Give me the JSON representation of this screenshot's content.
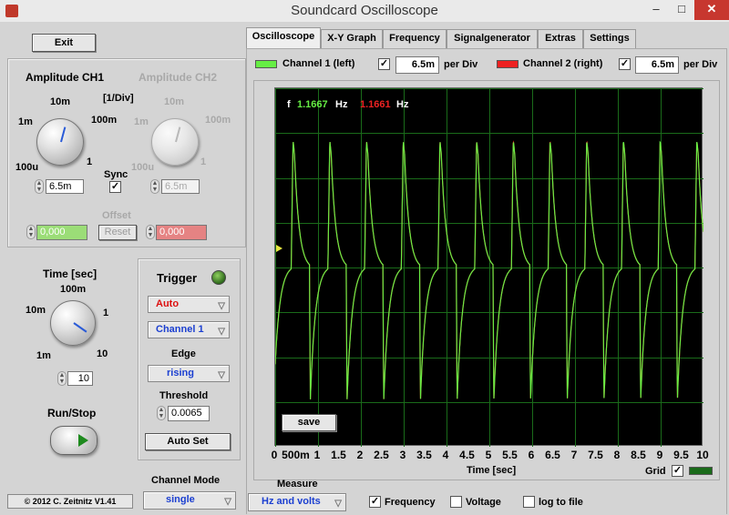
{
  "window": {
    "title": "Soundcard Oscilloscope",
    "minimize": "–",
    "maximize": "□",
    "close": "✕"
  },
  "exit_label": "Exit",
  "amplitude": {
    "ch1_title": "Amplitude CH1",
    "ch2_title": "Amplitude CH2",
    "unit": "[1/Div]",
    "ticks": {
      "t10m": "10m",
      "t100m": "100m",
      "t1m": "1m",
      "t1": "1",
      "t100u": "100u"
    },
    "ch1_value": "6.5m",
    "ch2_value": "6.5m",
    "sync_label": "Sync",
    "sync_checked": "✓",
    "offset_label": "Offset",
    "offset_ch1": "0,000",
    "offset_ch2": "0,000",
    "reset_label": "Reset"
  },
  "time": {
    "title": "Time [sec]",
    "ticks": {
      "t100m": "100m",
      "t10m": "10m",
      "t1": "1",
      "t1m": "1m",
      "t10": "10"
    },
    "value": "10"
  },
  "trigger": {
    "title": "Trigger",
    "mode": "Auto",
    "channel": "Channel 1",
    "edge_label": "Edge",
    "edge": "rising",
    "threshold_label": "Threshold",
    "threshold": "0.0065",
    "autoset_label": "Auto Set"
  },
  "runstop_label": "Run/Stop",
  "copyright": "© 2012  C. Zeitnitz V1.41",
  "channel_mode": {
    "label": "Channel Mode",
    "value": "single"
  },
  "tabs": [
    "Oscilloscope",
    "X-Y Graph",
    "Frequency",
    "Signalgenerator",
    "Extras",
    "Settings"
  ],
  "channels": {
    "ch1_label": "Channel 1 (left)",
    "ch1_color": "#66ee44",
    "ch1_checked": "✓",
    "ch1_div": "6.5m",
    "ch2_label": "Channel 2 (right)",
    "ch2_color": "#ee2222",
    "ch2_checked": "✓",
    "ch2_div": "6.5m",
    "per_div": "per Div"
  },
  "readout": {
    "f_label": "f",
    "ch1_freq": "1.1667",
    "ch2_freq": "1.1661",
    "unit": "Hz"
  },
  "save_label": "save",
  "x_axis": {
    "label": "Time [sec]",
    "ticks": [
      "0",
      "500m",
      "1",
      "1.5",
      "2",
      "2.5",
      "3",
      "3.5",
      "4",
      "4.5",
      "5",
      "5.5",
      "6",
      "6.5",
      "7",
      "7.5",
      "8",
      "8.5",
      "9",
      "9.5",
      "10"
    ]
  },
  "grid": {
    "label": "Grid",
    "checked": "✓",
    "color": "#1a6b1a"
  },
  "measure": {
    "title": "Measure",
    "mode": "Hz and volts",
    "frequency_label": "Frequency",
    "frequency_checked": "✓",
    "voltage_label": "Voltage",
    "log_label": "log to file"
  },
  "chart_data": {
    "type": "line",
    "xlabel": "Time [sec]",
    "xlim": [
      0,
      10
    ],
    "grid": true,
    "period_sec": 0.857,
    "frequency_hz": {
      "channel_1": 1.1667,
      "channel_2": 1.1661
    },
    "series": [
      {
        "name": "Channel 1 (left)",
        "color": "#66ee44"
      },
      {
        "name": "Channel 2 (right)",
        "color": "#ee2222"
      }
    ]
  }
}
